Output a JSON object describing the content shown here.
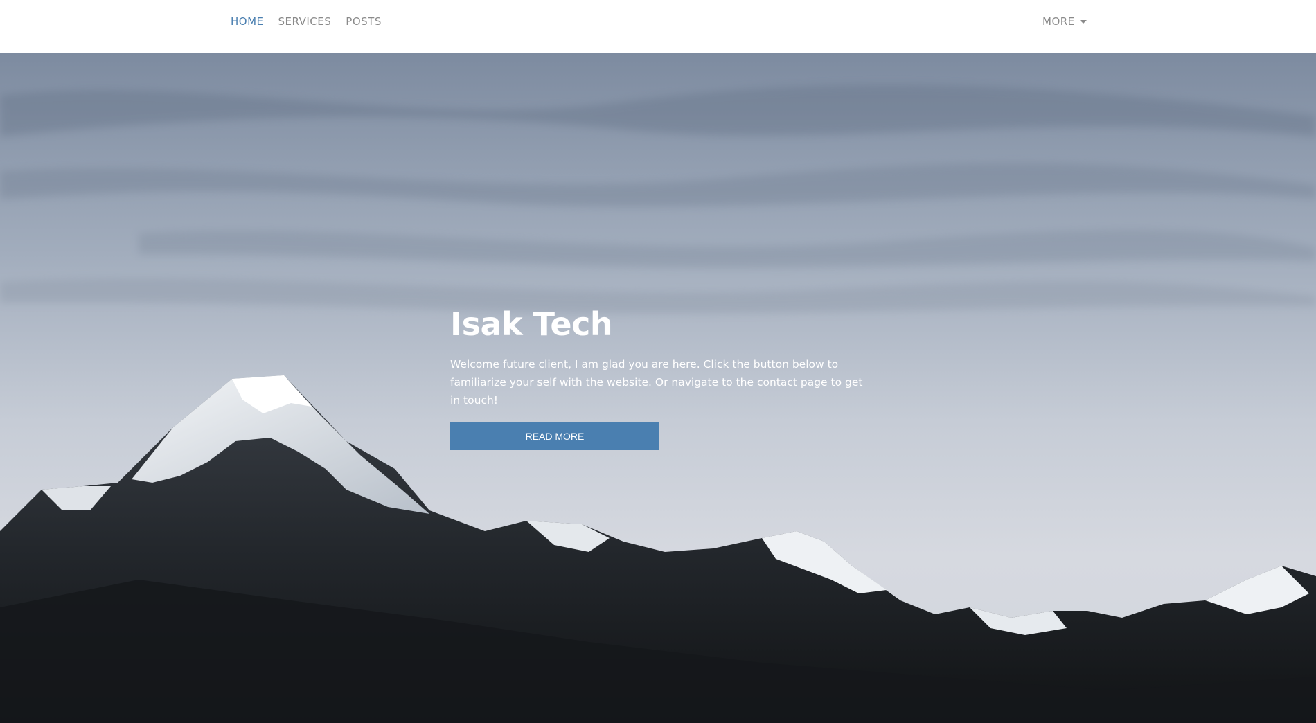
{
  "nav": {
    "home": "HOME",
    "services": "SERVICES",
    "posts": "POSTS",
    "more": "MORE"
  },
  "hero": {
    "title": "Isak Tech",
    "description": "Welcome future client, I am glad you are here. Click the button below to familiarize your self with the website. Or navigate to the contact page to get in touch!",
    "button_label": "READ MORE"
  },
  "colors": {
    "accent": "#4a7fb0",
    "nav_text": "#8a8a8a",
    "background": "#ffffff"
  },
  "icons": {
    "more_caret": "caret-down-icon"
  }
}
